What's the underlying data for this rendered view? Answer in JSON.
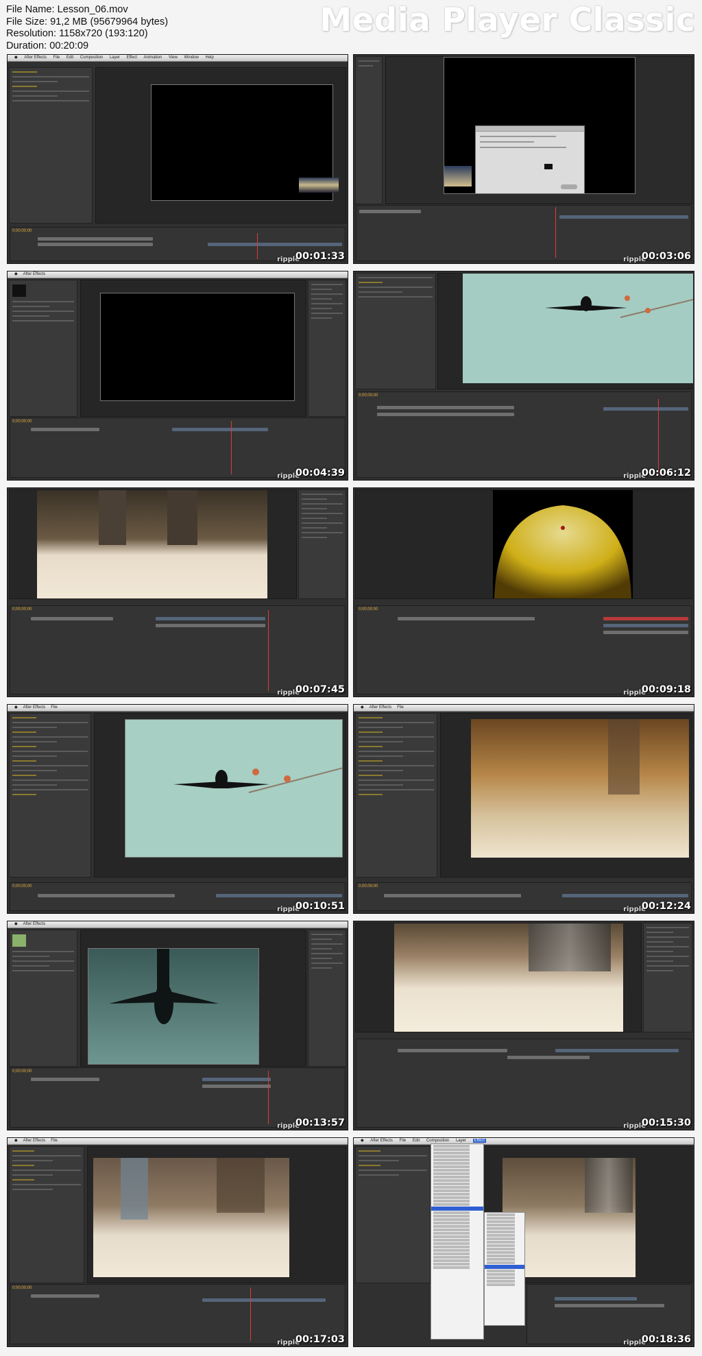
{
  "file_info": {
    "file_name": "File Name: Lesson_06.mov",
    "file_size": "File Size: 91,2 MB (95679964 bytes)",
    "resolution": "Resolution: 1158x720 (193:120)",
    "duration": "Duration: 00:20:09"
  },
  "brand": "Media Player Classic",
  "watermark": "ripple",
  "app_menu": [
    "After Effects",
    "File",
    "Edit",
    "Composition",
    "Layer",
    "Effect",
    "Animation",
    "View",
    "Window",
    "Help"
  ],
  "thumbnails": [
    {
      "time": "00:01:33",
      "scene": "black-comp"
    },
    {
      "time": "00:03:06",
      "scene": "dialog"
    },
    {
      "time": "00:04:39",
      "scene": "black-comp"
    },
    {
      "time": "00:06:12",
      "scene": "plane-sky"
    },
    {
      "time": "00:07:45",
      "scene": "legs-floor"
    },
    {
      "time": "00:09:18",
      "scene": "particles"
    },
    {
      "time": "00:10:51",
      "scene": "plane-sky-effects"
    },
    {
      "time": "00:12:24",
      "scene": "brown-blur"
    },
    {
      "time": "00:13:57",
      "scene": "plane-teal"
    },
    {
      "time": "00:15:30",
      "scene": "escalator"
    },
    {
      "time": "00:17:03",
      "scene": "legs-blur"
    },
    {
      "time": "00:18:36",
      "scene": "effect-menu"
    }
  ],
  "colors": {
    "timecode": "#e7b040",
    "sky": "#9fc8bd",
    "particles": "#e6c21a",
    "menu_highlight": "#2f5fd2"
  }
}
